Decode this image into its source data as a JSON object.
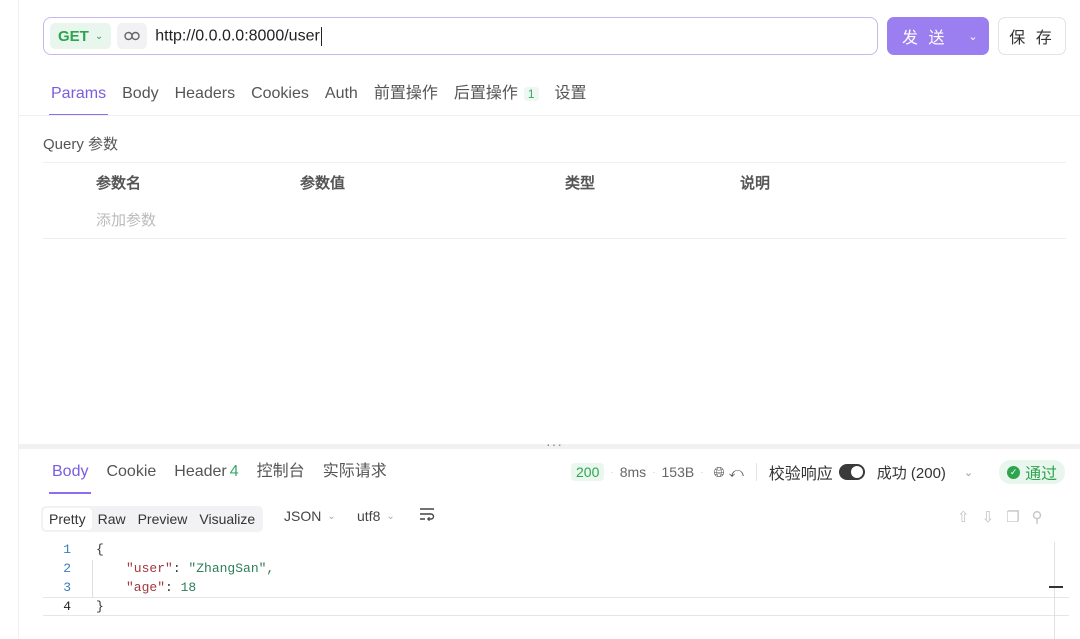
{
  "request": {
    "method": "GET",
    "url": "http://0.0.0.0:8000/user",
    "send_label": "发 送",
    "save_label": "保 存"
  },
  "request_tabs": [
    {
      "label": "Params",
      "active": true
    },
    {
      "label": "Body"
    },
    {
      "label": "Headers"
    },
    {
      "label": "Cookies"
    },
    {
      "label": "Auth"
    },
    {
      "label": "前置操作"
    },
    {
      "label": "后置操作",
      "badge": "1"
    },
    {
      "label": "设置"
    }
  ],
  "params": {
    "title": "Query 参数",
    "columns": [
      "参数名",
      "参数值",
      "类型",
      "说明"
    ],
    "add_placeholder": "添加参数"
  },
  "response_tabs": [
    {
      "label": "Body",
      "active": true
    },
    {
      "label": "Cookie"
    },
    {
      "label": "Header",
      "count": "4"
    },
    {
      "label": "控制台"
    },
    {
      "label": "实际请求"
    }
  ],
  "response_meta": {
    "status": "200",
    "time": "8ms",
    "size": "153B",
    "verify_label": "校验响应",
    "verify_on": true,
    "result_option": "成功 (200)",
    "pass_label": "通过"
  },
  "format": {
    "views": [
      "Pretty",
      "Raw",
      "Preview",
      "Visualize"
    ],
    "active_view": "Pretty",
    "type": "JSON",
    "encoding": "utf8"
  },
  "code_lines": [
    {
      "n": "1",
      "text": "{"
    },
    {
      "n": "2",
      "key": "\"user\"",
      "value": "\"ZhangSan\","
    },
    {
      "n": "3",
      "key": "\"age\"",
      "value": "18"
    },
    {
      "n": "4",
      "text": "}"
    }
  ],
  "colors": {
    "accent": "#9b7ef0",
    "success": "#2ea44f"
  }
}
